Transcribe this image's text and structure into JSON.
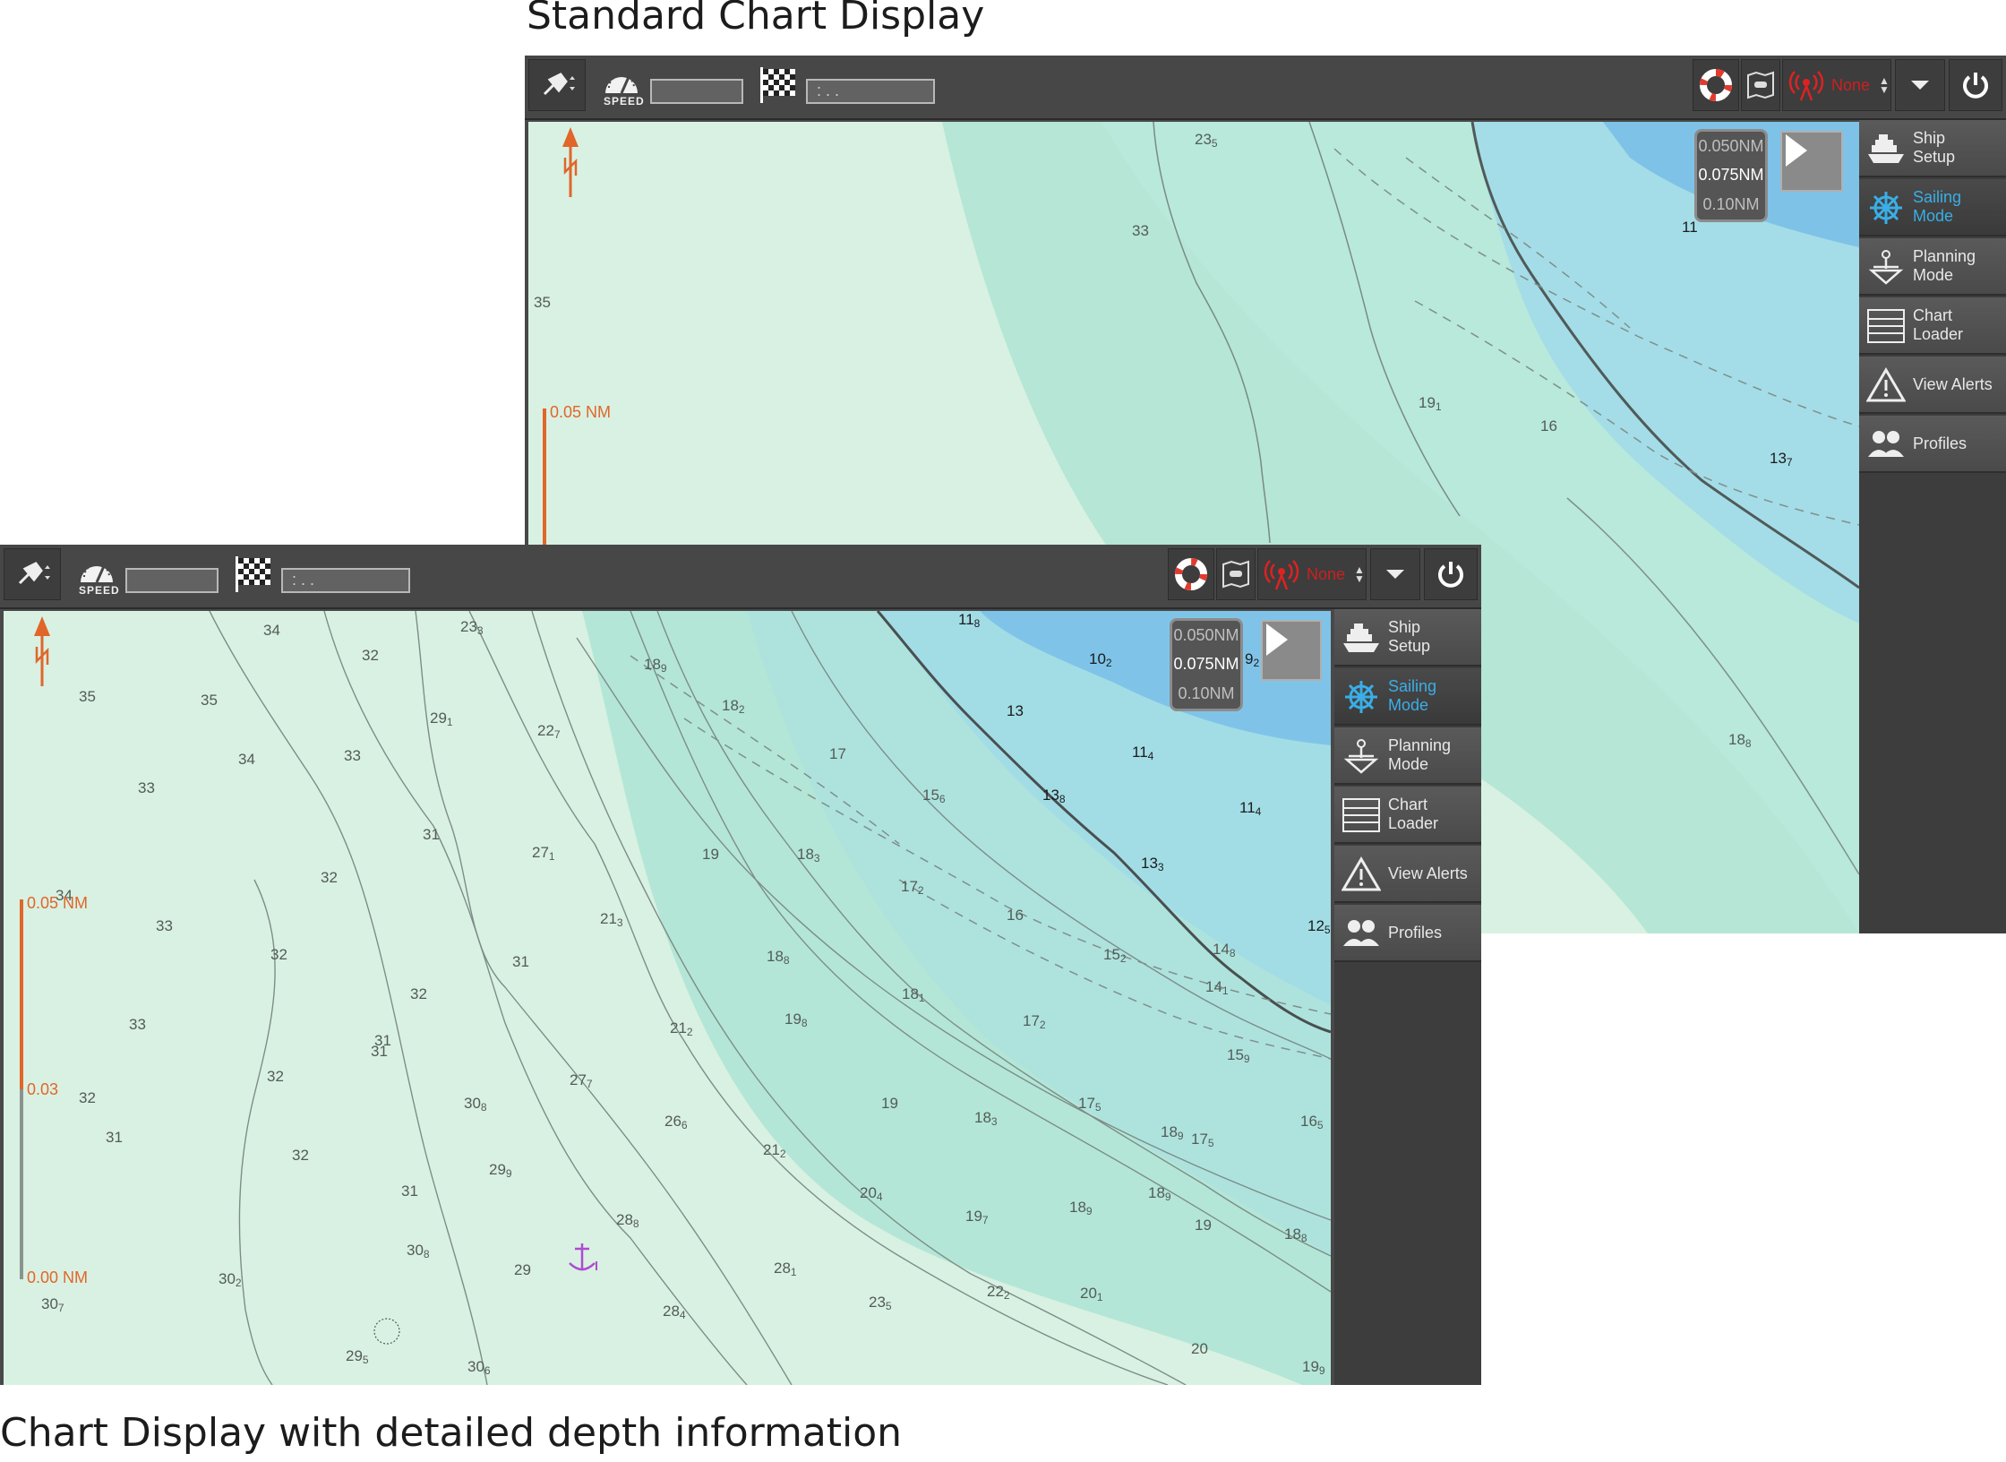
{
  "captions": {
    "top": "Standard Chart Display",
    "bottom": "Chart Display with detailed depth information"
  },
  "toolbar": {
    "speed_label": "SPEED",
    "speed_value": "",
    "waypoint_value": ":  . .",
    "alarm_value": "None"
  },
  "zoom_options": [
    "0.050NM",
    "0.075NM",
    "0.10NM"
  ],
  "zoom_selected": "0.075NM",
  "sidebar": {
    "items": [
      {
        "line1": "Ship",
        "line2": "Setup",
        "icon": "ship-icon"
      },
      {
        "line1": "Sailing",
        "line2": "Mode",
        "icon": "helm-wheel-icon",
        "active": true
      },
      {
        "line1": "Planning",
        "line2": "Mode",
        "icon": "planning-icon"
      },
      {
        "line1": "Chart",
        "line2": "Loader",
        "icon": "chart-loader-icon"
      },
      {
        "line1": "View Alerts",
        "line2": "",
        "icon": "alert-icon"
      },
      {
        "line1": "Profiles",
        "line2": "",
        "icon": "profiles-icon"
      }
    ]
  },
  "top_chart": {
    "scale_label": "0.05 NM",
    "depths": [
      {
        "v": "23",
        "s": "5"
      },
      {
        "v": "33",
        "s": ""
      },
      {
        "v": "35",
        "s": ""
      },
      {
        "v": "19",
        "s": "1"
      },
      {
        "v": "11",
        "s": ""
      },
      {
        "v": "13",
        "s": "7"
      },
      {
        "v": "16",
        "s": ""
      },
      {
        "v": "18",
        "s": "8"
      }
    ]
  },
  "bottom_chart": {
    "scale_labels": [
      "0.05 NM",
      "0.03",
      "0.00 NM"
    ],
    "depths": [
      {
        "v": "34",
        "s": ""
      },
      {
        "v": "32",
        "s": ""
      },
      {
        "v": "23",
        "s": "3"
      },
      {
        "v": "35",
        "s": ""
      },
      {
        "v": "35",
        "s": ""
      },
      {
        "v": "29",
        "s": "1"
      },
      {
        "v": "22",
        "s": "7"
      },
      {
        "v": "33",
        "s": ""
      },
      {
        "v": "33",
        "s": ""
      },
      {
        "v": "34",
        "s": ""
      },
      {
        "v": "31",
        "s": ""
      },
      {
        "v": "27",
        "s": "1"
      },
      {
        "v": "32",
        "s": ""
      },
      {
        "v": "34",
        "s": ""
      },
      {
        "v": "33",
        "s": ""
      },
      {
        "v": "32",
        "s": ""
      },
      {
        "v": "31",
        "s": ""
      },
      {
        "v": "21",
        "s": "3"
      },
      {
        "v": "32",
        "s": ""
      },
      {
        "v": "33",
        "s": ""
      },
      {
        "v": "31",
        "s": ""
      },
      {
        "v": "27",
        "s": "7"
      },
      {
        "v": "21",
        "s": "2"
      },
      {
        "v": "32",
        "s": ""
      },
      {
        "v": "30",
        "s": "8"
      },
      {
        "v": "32",
        "s": ""
      },
      {
        "v": "31",
        "s": ""
      },
      {
        "v": "26",
        "s": "6"
      },
      {
        "v": "31",
        "s": ""
      },
      {
        "v": "32",
        "s": ""
      },
      {
        "v": "29",
        "s": "9"
      },
      {
        "v": "21",
        "s": "2"
      },
      {
        "v": "31",
        "s": ""
      },
      {
        "v": "28",
        "s": "8"
      },
      {
        "v": "30",
        "s": "8"
      },
      {
        "v": "29",
        "s": ""
      },
      {
        "v": "30",
        "s": "2"
      },
      {
        "v": "28",
        "s": "1"
      },
      {
        "v": "30",
        "s": "7"
      },
      {
        "v": "28",
        "s": "4"
      },
      {
        "v": "23",
        "s": "5"
      },
      {
        "v": "29",
        "s": "5"
      },
      {
        "v": "30",
        "s": "6"
      },
      {
        "v": "18",
        "s": "9"
      },
      {
        "v": "18",
        "s": "2"
      },
      {
        "v": "17",
        "s": ""
      },
      {
        "v": "15",
        "s": "6"
      },
      {
        "v": "19",
        "s": ""
      },
      {
        "v": "18",
        "s": "3"
      },
      {
        "v": "17",
        "s": "2"
      },
      {
        "v": "18",
        "s": "8"
      },
      {
        "v": "18",
        "s": "1"
      },
      {
        "v": "19",
        "s": "8"
      },
      {
        "v": "19",
        "s": ""
      },
      {
        "v": "18",
        "s": "3"
      },
      {
        "v": "20",
        "s": "4"
      },
      {
        "v": "19",
        "s": "7"
      },
      {
        "v": "22",
        "s": "2"
      },
      {
        "v": "14",
        "s": "8"
      },
      {
        "v": "16",
        "s": ""
      },
      {
        "v": "15",
        "s": "2"
      },
      {
        "v": "17",
        "s": "2"
      },
      {
        "v": "17",
        "s": "5"
      },
      {
        "v": "18",
        "s": "9"
      },
      {
        "v": "20",
        "s": "1"
      },
      {
        "v": "15",
        "s": "9"
      },
      {
        "v": "17",
        "s": "5"
      },
      {
        "v": "19",
        "s": ""
      },
      {
        "v": "16",
        "s": "5"
      },
      {
        "v": "18",
        "s": "8"
      },
      {
        "v": "20",
        "s": ""
      },
      {
        "v": "19",
        "s": "9"
      },
      {
        "v": "14",
        "s": "1"
      },
      {
        "v": "18",
        "s": "9"
      },
      {
        "v": "18",
        "s": "9"
      },
      {
        "v": "11",
        "s": "8"
      },
      {
        "v": "10",
        "s": "2"
      },
      {
        "v": "9",
        "s": "2"
      },
      {
        "v": "13",
        "s": ""
      },
      {
        "v": "11",
        "s": "4"
      },
      {
        "v": "11",
        "s": "4"
      },
      {
        "v": "13",
        "s": "8"
      },
      {
        "v": "13",
        "s": "3"
      },
      {
        "v": "12",
        "s": "5"
      }
    ]
  }
}
